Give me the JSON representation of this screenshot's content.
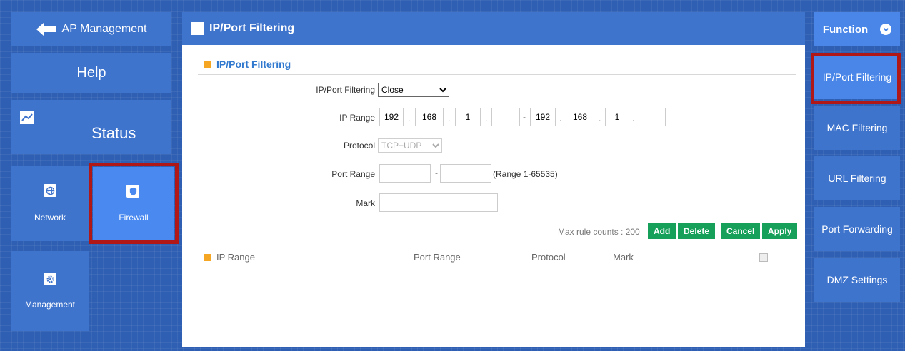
{
  "nav": {
    "back_label": "AP Management",
    "help_label": "Help",
    "status_label": "Status",
    "network_label": "Network",
    "firewall_label": "Firewall",
    "management_label": "Management"
  },
  "main": {
    "header_title": "IP/Port Filtering",
    "section_title": "IP/Port Filtering",
    "form": {
      "filter_label": "IP/Port Filtering",
      "filter_value": "Close",
      "ip_range_label": "IP Range",
      "ip_start": [
        "192",
        "168",
        "1",
        ""
      ],
      "ip_end": [
        "192",
        "168",
        "1",
        ""
      ],
      "ip_separator": "-",
      "octet_separator": ".",
      "protocol_label": "Protocol",
      "protocol_value": "TCP+UDP",
      "port_range_label": "Port Range",
      "port_start": "",
      "port_end": "",
      "port_separator": "-",
      "port_hint": "(Range 1-65535)",
      "mark_label": "Mark",
      "mark_value": ""
    },
    "max_rule_text": "Max rule counts : 200",
    "buttons": {
      "add": "Add",
      "delete": "Delete",
      "cancel": "Cancel",
      "apply": "Apply"
    },
    "table_headers": {
      "ip_range": "IP Range",
      "port_range": "Port Range",
      "protocol": "Protocol",
      "mark": "Mark"
    }
  },
  "function_menu": {
    "title": "Function",
    "items": [
      "IP/Port Filtering",
      "MAC Filtering",
      "URL Filtering",
      "Port Forwarding",
      "DMZ Settings"
    ],
    "active_index": 0
  },
  "colors": {
    "background": "#2f5fb3",
    "tile": "#3f74cd",
    "tile_active": "#4a86e8",
    "highlight_border": "#b01818",
    "button_green": "#16a05a",
    "section_accent": "#f5a623",
    "section_title": "#3079cf"
  }
}
